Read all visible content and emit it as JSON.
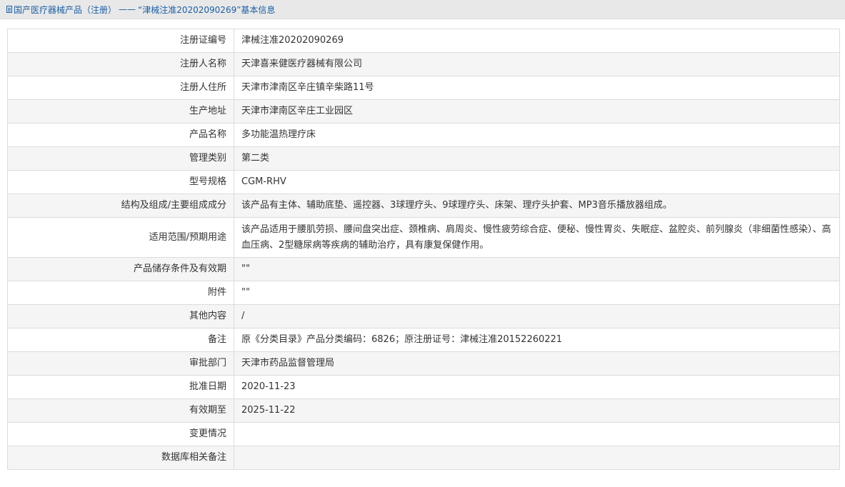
{
  "breadcrumb": {
    "icon": "document-icon",
    "link": "国产医疗器械产品（注册）",
    "separator": "——",
    "current": "“津械注准20202090269”基本信息"
  },
  "rows": [
    {
      "label": "注册证编号",
      "value": "津械注准20202090269"
    },
    {
      "label": "注册人名称",
      "value": "天津喜来健医疗器械有限公司"
    },
    {
      "label": "注册人住所",
      "value": "天津市津南区辛庄镇辛柴路11号"
    },
    {
      "label": "生产地址",
      "value": "天津市津南区辛庄工业园区"
    },
    {
      "label": "产品名称",
      "value": "多功能温热理疗床"
    },
    {
      "label": "管理类别",
      "value": "第二类"
    },
    {
      "label": "型号规格",
      "value": "CGM-RHV"
    },
    {
      "label": "结构及组成/主要组成成分",
      "value": "该产品有主体、辅助底垫、遥控器、3球理疗头、9球理疗头、床架、理疗头护套、MP3音乐播放器组成。"
    },
    {
      "label": "适用范围/预期用途",
      "value": "该产品适用于腰肌劳损、腰间盘突出症、颈椎病、肩周炎、慢性疲劳综合症、便秘、慢性胃炎、失眠症、盆腔炎、前列腺炎（非细菌性感染）、高血压病、2型糖尿病等疾病的辅助治疗，具有康复保健作用。"
    },
    {
      "label": "产品储存条件及有效期",
      "value": "\"\""
    },
    {
      "label": "附件",
      "value": "\"\""
    },
    {
      "label": "其他内容",
      "value": "/"
    },
    {
      "label": "备注",
      "value": "原《分类目录》产品分类编码：6826；原注册证号：津械注准20152260221"
    },
    {
      "label": "审批部门",
      "value": "天津市药品监督管理局"
    },
    {
      "label": "批准日期",
      "value": "2020-11-23"
    },
    {
      "label": "有效期至",
      "value": "2025-11-22"
    },
    {
      "label": "变更情况",
      "value": ""
    },
    {
      "label": "数据库相关备注",
      "value": ""
    }
  ]
}
